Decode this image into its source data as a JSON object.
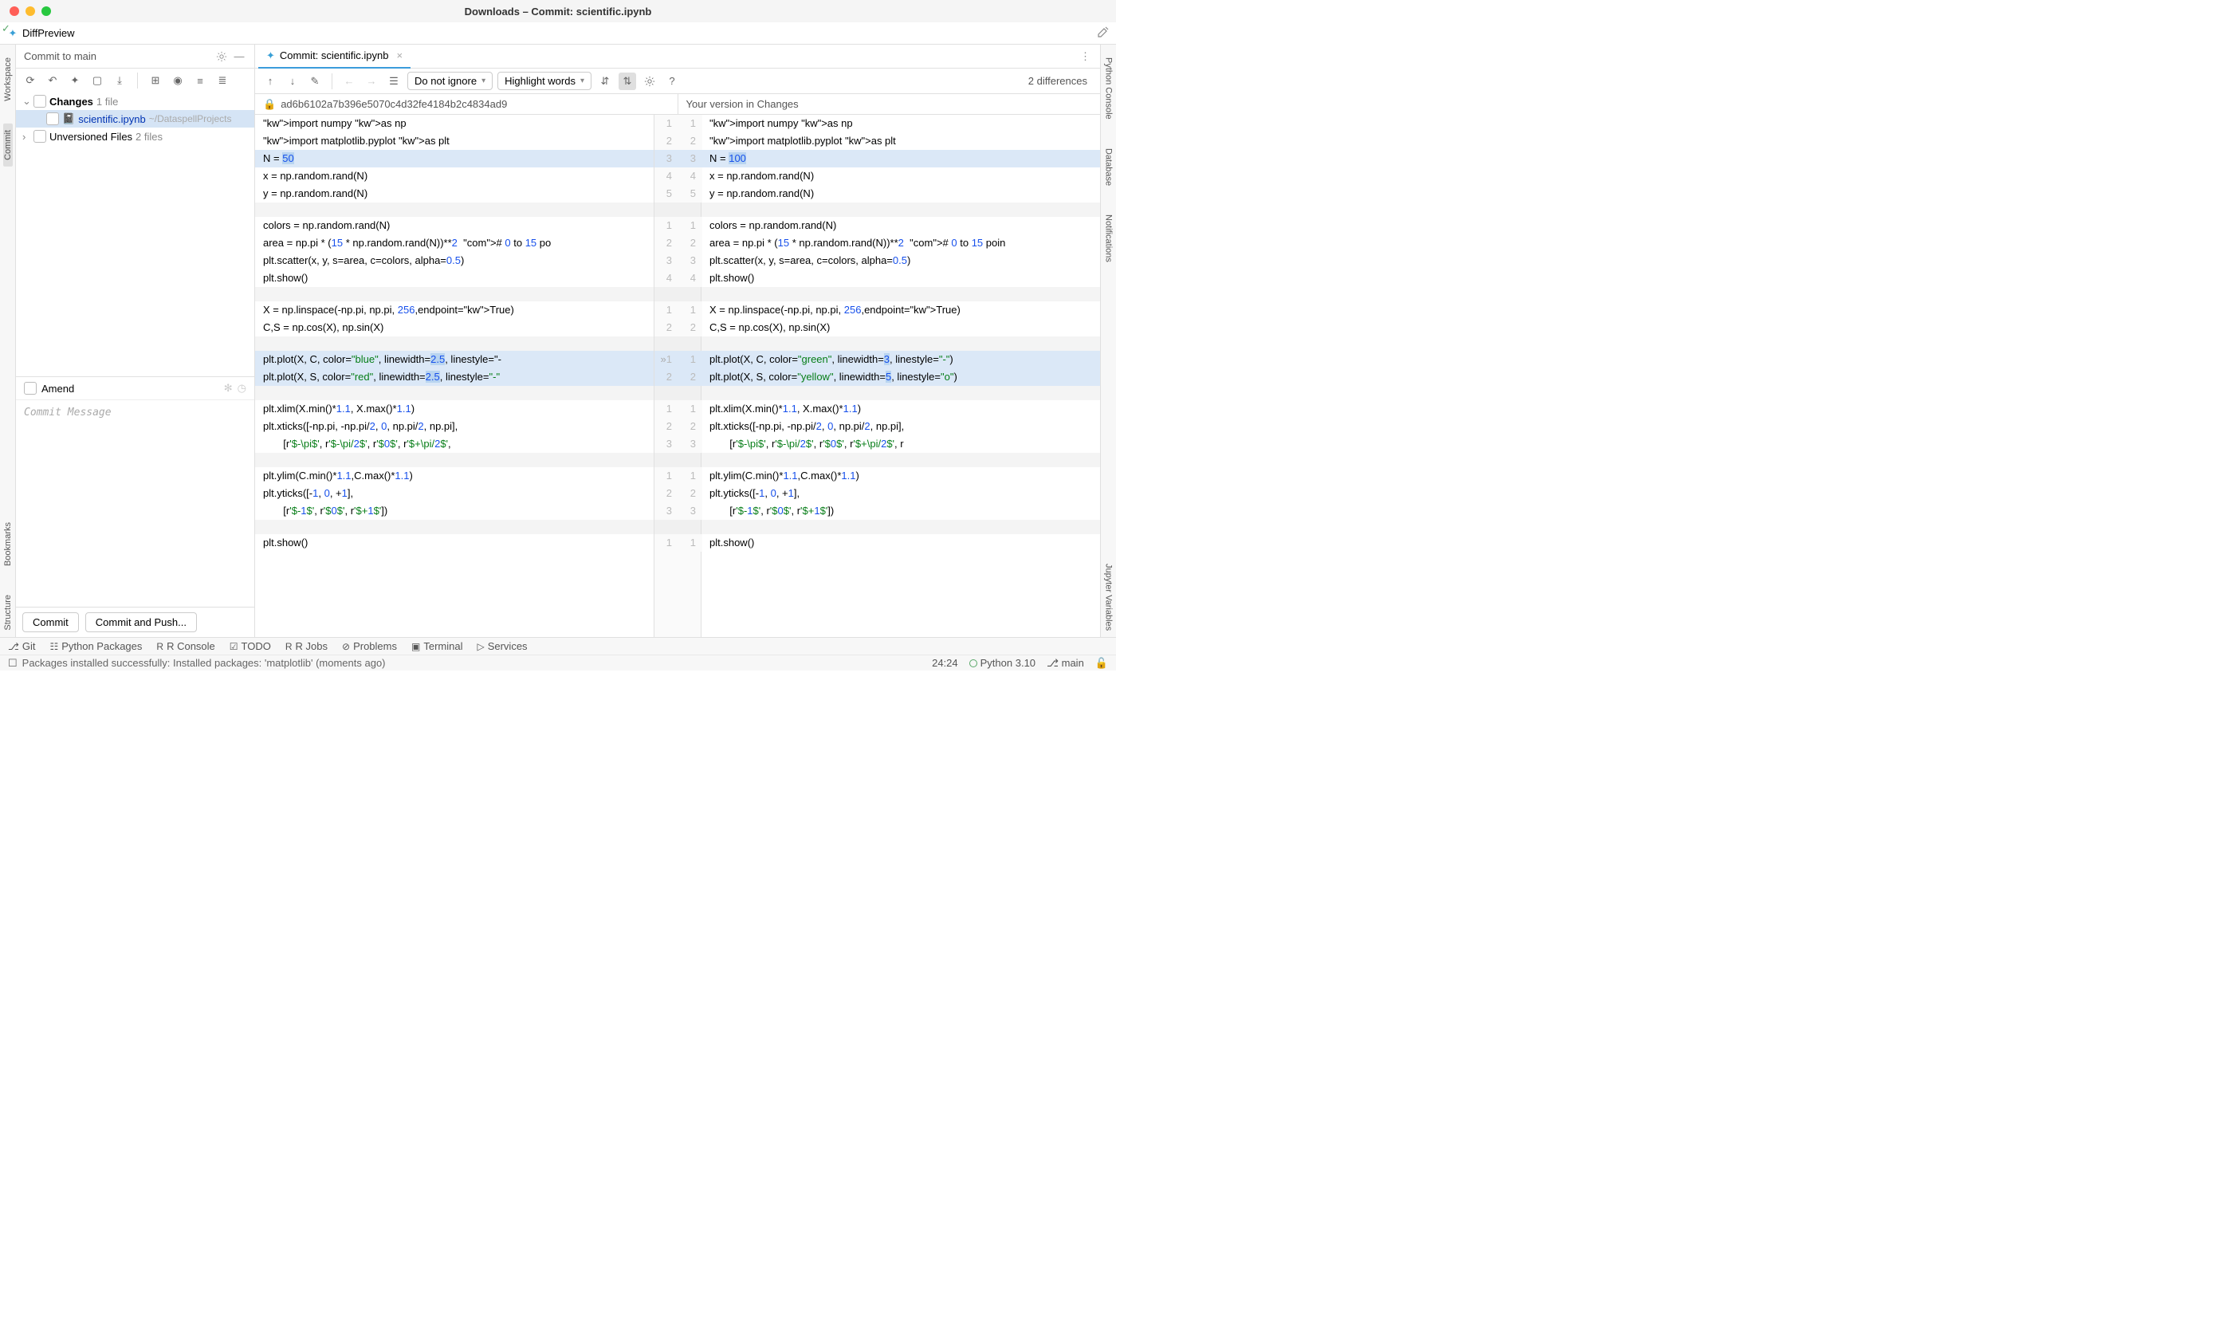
{
  "windowTitle": "Downloads – Commit: scientific.ipynb",
  "menuBar": {
    "diffPreview": "DiffPreview"
  },
  "leftRail": [
    "Workspace",
    "Commit",
    "Bookmarks",
    "Structure"
  ],
  "rightRail": [
    "Python Console",
    "Database",
    "Notifications",
    "Jupyter Variables"
  ],
  "commitPanel": {
    "title": "Commit to main",
    "changes": {
      "label": "Changes",
      "count": "1 file"
    },
    "file": {
      "name": "scientific.ipynb",
      "path": "~/DataspellProjects"
    },
    "unversioned": {
      "label": "Unversioned Files",
      "count": "2 files"
    },
    "amend": "Amend",
    "msgPlaceholder": "Commit Message",
    "btnCommit": "Commit",
    "btnCommitPush": "Commit and Push..."
  },
  "editor": {
    "tab": "Commit: scientific.ipynb",
    "selIgnore": "Do not ignore",
    "selHighlight": "Highlight words",
    "diffCount": "2 differences",
    "revLeft": "ad6b6102a7b396e5070c4d32fe4184b2c4834ad9",
    "revRight": "Your version in Changes"
  },
  "code": {
    "cells_left": [
      {
        "lines": [
          "import numpy as np",
          "import matplotlib.pyplot as plt",
          "N = 50",
          "x = np.random.rand(N)",
          "y = np.random.rand(N)"
        ],
        "ln": [
          "1",
          "2",
          "3",
          "4",
          "5"
        ],
        "changed": [
          2
        ]
      },
      {
        "lines": [
          "colors = np.random.rand(N)",
          "area = np.pi * (15 * np.random.rand(N))**2  # 0 to 15 po",
          "plt.scatter(x, y, s=area, c=colors, alpha=0.5)",
          "plt.show()"
        ],
        "ln": [
          "1",
          "2",
          "3",
          "4"
        ]
      },
      {
        "lines": [
          "X = np.linspace(-np.pi, np.pi, 256,endpoint=True)",
          "C,S = np.cos(X), np.sin(X)"
        ],
        "ln": [
          "1",
          "2"
        ]
      },
      {
        "lines": [
          "plt.plot(X, C, color=\"blue\", linewidth=2.5, linestyle=\"-",
          "plt.plot(X, S, color=\"red\", linewidth=2.5, linestyle=\"-\""
        ],
        "ln": [
          "1",
          "2"
        ],
        "changed": [
          0,
          1
        ]
      },
      {
        "lines": [
          "plt.xlim(X.min()*1.1, X.max()*1.1)",
          "plt.xticks([-np.pi, -np.pi/2, 0, np.pi/2, np.pi],",
          "       [r'$-\\pi$', r'$-\\pi/2$', r'$0$', r'$+\\pi/2$',"
        ],
        "ln": [
          "1",
          "2",
          "3"
        ]
      },
      {
        "lines": [
          "plt.ylim(C.min()*1.1,C.max()*1.1)",
          "plt.yticks([-1, 0, +1],",
          "       [r'$-1$', r'$0$', r'$+1$'])"
        ],
        "ln": [
          "1",
          "2",
          "3"
        ]
      },
      {
        "lines": [
          "plt.show()"
        ],
        "ln": [
          "1"
        ]
      }
    ],
    "cells_right": [
      {
        "lines": [
          "import numpy as np",
          "import matplotlib.pyplot as plt",
          "N = 100",
          "x = np.random.rand(N)",
          "y = np.random.rand(N)"
        ],
        "ln": [
          "1",
          "2",
          "3",
          "4",
          "5"
        ],
        "changed": [
          2
        ]
      },
      {
        "lines": [
          "colors = np.random.rand(N)",
          "area = np.pi * (15 * np.random.rand(N))**2  # 0 to 15 poin",
          "plt.scatter(x, y, s=area, c=colors, alpha=0.5)",
          "plt.show()"
        ],
        "ln": [
          "1",
          "2",
          "3",
          "4"
        ]
      },
      {
        "lines": [
          "X = np.linspace(-np.pi, np.pi, 256,endpoint=True)",
          "C,S = np.cos(X), np.sin(X)"
        ],
        "ln": [
          "1",
          "2"
        ]
      },
      {
        "lines": [
          "plt.plot(X, C, color=\"green\", linewidth=3, linestyle=\"-\")",
          "plt.plot(X, S, color=\"yellow\", linewidth=5, linestyle=\"o\")"
        ],
        "ln": [
          "1",
          "2"
        ],
        "changed": [
          0,
          1
        ]
      },
      {
        "lines": [
          "plt.xlim(X.min()*1.1, X.max()*1.1)",
          "plt.xticks([-np.pi, -np.pi/2, 0, np.pi/2, np.pi],",
          "       [r'$-\\pi$', r'$-\\pi/2$', r'$0$', r'$+\\pi/2$', r"
        ],
        "ln": [
          "1",
          "2",
          "3"
        ]
      },
      {
        "lines": [
          "plt.ylim(C.min()*1.1,C.max()*1.1)",
          "plt.yticks([-1, 0, +1],",
          "       [r'$-1$', r'$0$', r'$+1$'])"
        ],
        "ln": [
          "1",
          "2",
          "3"
        ]
      },
      {
        "lines": [
          "plt.show()"
        ],
        "ln": [
          "1"
        ]
      }
    ]
  },
  "bottomBar": [
    "Git",
    "Python Packages",
    "R Console",
    "TODO",
    "R Jobs",
    "Problems",
    "Terminal",
    "Services"
  ],
  "statusBar": {
    "msg": "Packages installed successfully: Installed packages: 'matplotlib' (moments ago)",
    "pos": "24:24",
    "interp": "Python 3.10",
    "branch": "main"
  }
}
